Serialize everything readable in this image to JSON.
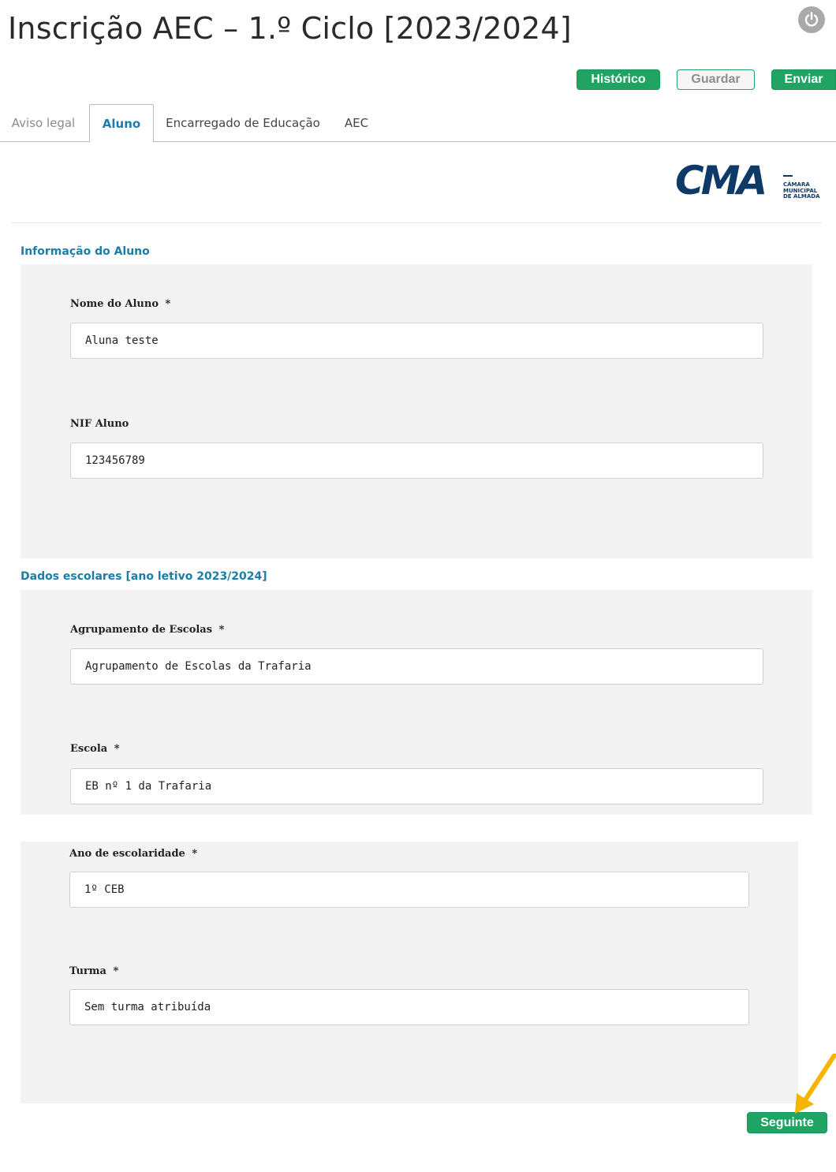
{
  "header": {
    "title": "Inscrição AEC – 1.º Ciclo [2023/2024]",
    "power_icon": "power-icon"
  },
  "toolbar": {
    "historico_label": "Histórico",
    "guardar_label": "Guardar",
    "enviar_label": "Enviar"
  },
  "tabs": [
    {
      "label": "Aviso legal",
      "state": "muted"
    },
    {
      "label": "Aluno",
      "state": "active"
    },
    {
      "label": "Encarregado de Educação",
      "state": "normal"
    },
    {
      "label": "AEC",
      "state": "normal"
    }
  ],
  "logo": {
    "main": "CMA",
    "line1": "CÂMARA",
    "line2": "MUNICIPAL",
    "line3": "DE ALMADA"
  },
  "sections": {
    "aluno_title": "Informação do Aluno",
    "escolares_title": "Dados escolares [ano letivo 2023/2024]"
  },
  "fields": {
    "nome": {
      "label": "Nome do Aluno",
      "required": "*",
      "value": "Aluna teste"
    },
    "nif": {
      "label": "NIF Aluno",
      "value": "123456789"
    },
    "agrupamento": {
      "label": "Agrupamento de Escolas",
      "required": "*",
      "value": "Agrupamento de Escolas da Trafaria"
    },
    "escola": {
      "label": "Escola",
      "required": "*",
      "value": "EB nº 1 da Trafaria"
    },
    "ano": {
      "label": "Ano de escolaridade",
      "required": "*",
      "value": "1º CEB"
    },
    "turma": {
      "label": "Turma",
      "required": "*",
      "value": "Sem turma atribuída"
    }
  },
  "footer": {
    "next_label": "Seguinte"
  },
  "colors": {
    "accent_green": "#1fa463",
    "section_blue": "#1a7ea8",
    "logo_navy": "#0e3a68",
    "arrow_yellow": "#f5b400"
  }
}
